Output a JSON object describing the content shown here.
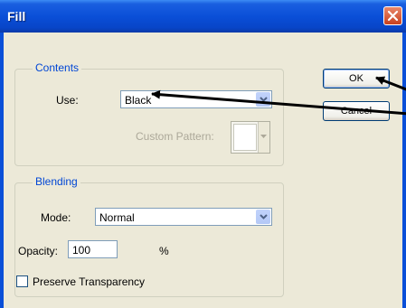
{
  "window": {
    "title": "Fill"
  },
  "contents": {
    "legend": "Contents",
    "use_label": "Use:",
    "use_value": "Black",
    "custom_pattern_label": "Custom Pattern:"
  },
  "blending": {
    "legend": "Blending",
    "mode_label": "Mode:",
    "mode_value": "Normal",
    "opacity_label": "Opacity:",
    "opacity_value": "100",
    "opacity_unit": "%",
    "preserve_label": "Preserve Transparency",
    "preserve_checked": false
  },
  "buttons": {
    "ok": "OK",
    "cancel": "Cancel"
  },
  "icons": [
    "close-icon",
    "dropdown-arrow-icon",
    "pattern-swatch",
    "callout-arrow"
  ]
}
